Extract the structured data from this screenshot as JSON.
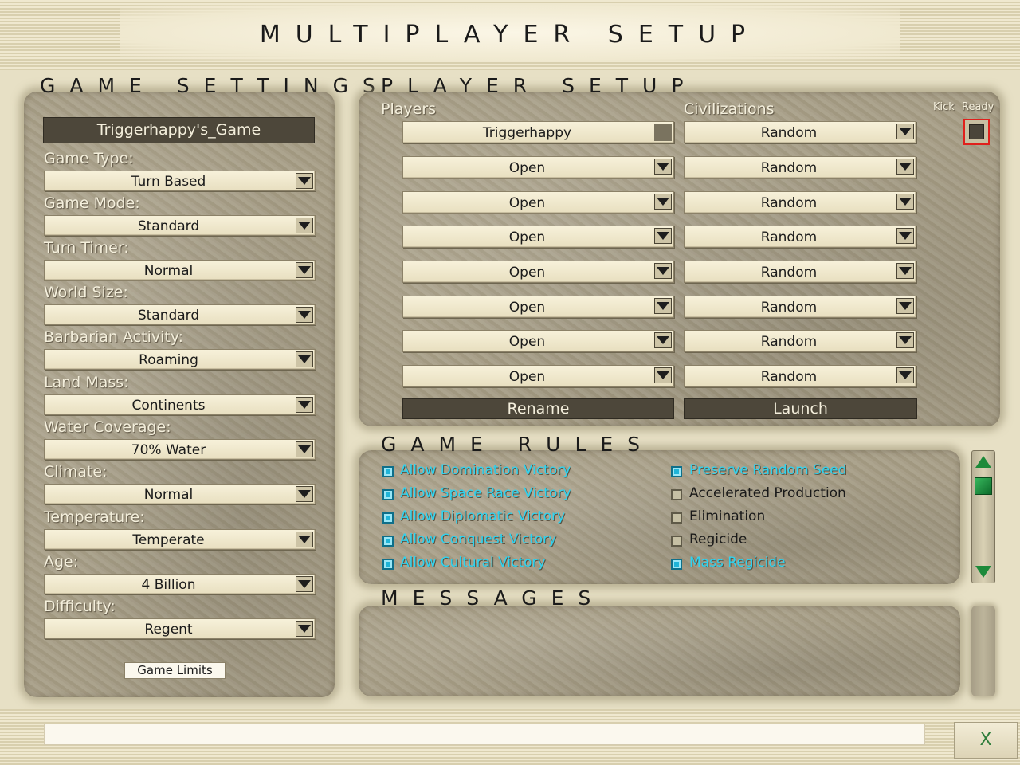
{
  "title": "MULTIPLAYER SETUP",
  "game_settings": {
    "title": "GAME SETTINGS",
    "game_name": "Triggerhappy's_Game",
    "fields": [
      {
        "label": "Game Type:",
        "value": "Turn Based"
      },
      {
        "label": "Game Mode:",
        "value": "Standard"
      },
      {
        "label": "Turn Timer:",
        "value": "Normal"
      },
      {
        "label": "World Size:",
        "value": "Standard"
      },
      {
        "label": "Barbarian Activity:",
        "value": "Roaming"
      },
      {
        "label": "Land Mass:",
        "value": "Continents"
      },
      {
        "label": "Water Coverage:",
        "value": "70% Water"
      },
      {
        "label": "Climate:",
        "value": "Normal"
      },
      {
        "label": "Temperature:",
        "value": "Temperate"
      },
      {
        "label": "Age:",
        "value": "4 Billion"
      },
      {
        "label": "Difficulty:",
        "value": "Regent"
      }
    ],
    "game_limits_label": "Game Limits"
  },
  "player_setup": {
    "title": "PLAYER SETUP",
    "players_header": "Players",
    "civs_header": "Civilizations",
    "kick_header": "Kick",
    "ready_header": "Ready",
    "rows": [
      {
        "player": "Triggerhappy",
        "civ": "Random"
      },
      {
        "player": "Open",
        "civ": "Random"
      },
      {
        "player": "Open",
        "civ": "Random"
      },
      {
        "player": "Open",
        "civ": "Random"
      },
      {
        "player": "Open",
        "civ": "Random"
      },
      {
        "player": "Open",
        "civ": "Random"
      },
      {
        "player": "Open",
        "civ": "Random"
      },
      {
        "player": "Open",
        "civ": "Random"
      }
    ],
    "rename_label": "Rename",
    "launch_label": "Launch"
  },
  "game_rules": {
    "title": "GAME RULES",
    "left": [
      {
        "label": "Allow Domination Victory",
        "checked": true
      },
      {
        "label": "Allow Space Race Victory",
        "checked": true
      },
      {
        "label": "Allow Diplomatic Victory",
        "checked": true
      },
      {
        "label": "Allow Conquest Victory",
        "checked": true
      },
      {
        "label": "Allow Cultural Victory",
        "checked": true
      }
    ],
    "right": [
      {
        "label": "Preserve Random Seed",
        "checked": true
      },
      {
        "label": "Accelerated Production",
        "checked": false
      },
      {
        "label": "Elimination",
        "checked": false
      },
      {
        "label": "Regicide",
        "checked": false
      },
      {
        "label": "Mass Regicide",
        "checked": true
      }
    ]
  },
  "messages": {
    "title": "MESSAGES"
  },
  "bottom": {
    "close_label": "X"
  },
  "colors": {
    "checked": "#1fb4d8",
    "checked_text": "#2fd3f0",
    "ready_border": "#e0201c",
    "dark_button": "#4d473a"
  }
}
